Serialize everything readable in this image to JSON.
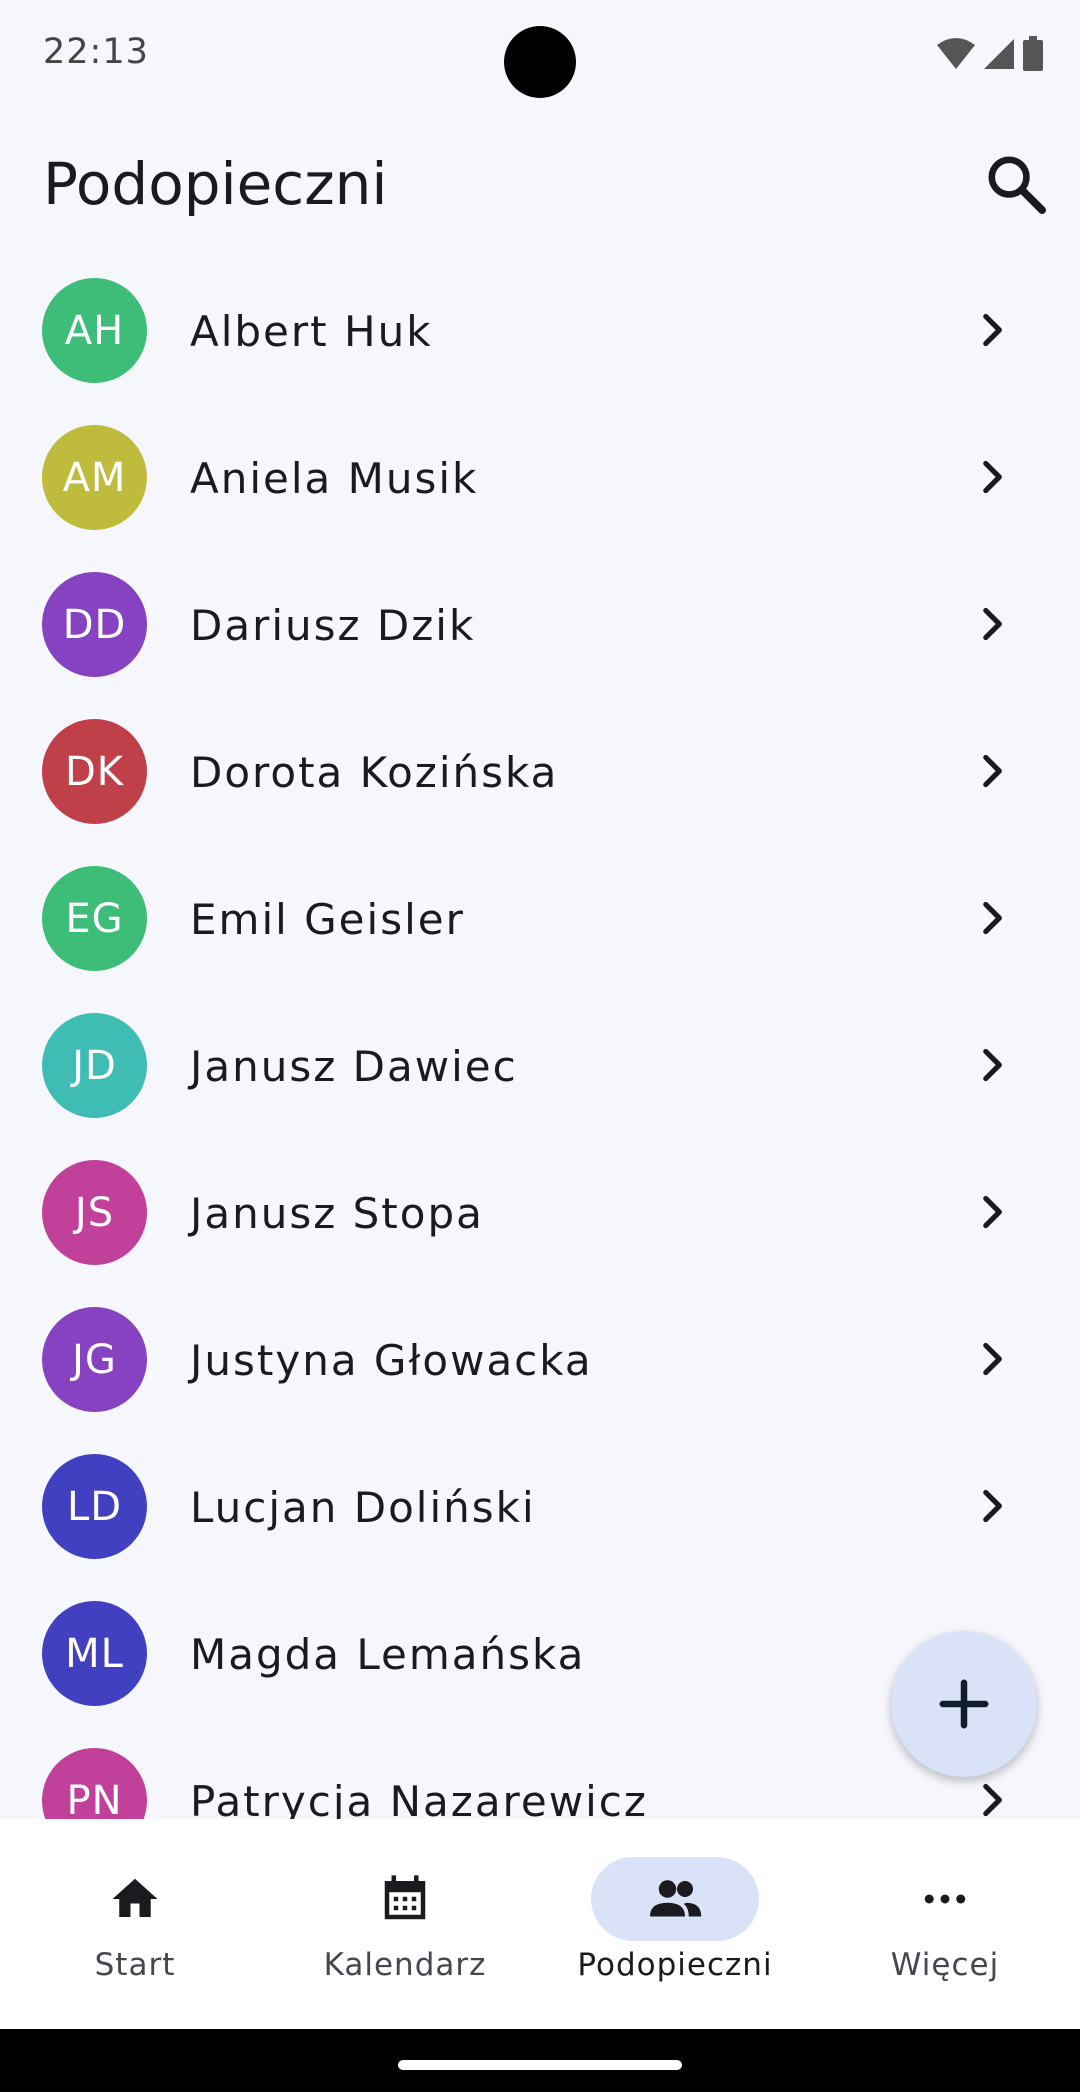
{
  "status_bar": {
    "time": "22:13"
  },
  "header": {
    "title": "Podopieczni",
    "search_icon": "search-icon"
  },
  "clients": [
    {
      "initials": "AH",
      "name": "Albert Huk",
      "color": "#3ebd78"
    },
    {
      "initials": "AM",
      "name": "Aniela Musik",
      "color": "#bfbb3d"
    },
    {
      "initials": "DD",
      "name": "Dariusz Dzik",
      "color": "#8642c0"
    },
    {
      "initials": "DK",
      "name": "Dorota Kozińska",
      "color": "#c0404a"
    },
    {
      "initials": "EG",
      "name": "Emil Geisler",
      "color": "#3ebd78"
    },
    {
      "initials": "JD",
      "name": "Janusz Dawiec",
      "color": "#3fbdb4"
    },
    {
      "initials": "JS",
      "name": "Janusz Stopa",
      "color": "#c0409a"
    },
    {
      "initials": "JG",
      "name": "Justyna Głowacka",
      "color": "#8642c0"
    },
    {
      "initials": "LD",
      "name": "Lucjan Doliński",
      "color": "#4040c0"
    },
    {
      "initials": "ML",
      "name": "Magda Lemańska",
      "color": "#4040c0"
    },
    {
      "initials": "PN",
      "name": "Patrycja Nazarewicz",
      "color": "#c0409a"
    }
  ],
  "fab": {
    "icon": "plus-icon"
  },
  "bottom_nav": {
    "items": [
      {
        "label": "Start",
        "icon": "home-icon",
        "active": false
      },
      {
        "label": "Kalendarz",
        "icon": "calendar-icon",
        "active": false
      },
      {
        "label": "Podopieczni",
        "icon": "people-icon",
        "active": true
      },
      {
        "label": "Więcej",
        "icon": "more-horizontal-icon",
        "active": false
      }
    ]
  },
  "colors": {
    "background": "#f6f7fd",
    "accent_container": "#d9e2f7",
    "text_primary": "#1b1b1f"
  }
}
